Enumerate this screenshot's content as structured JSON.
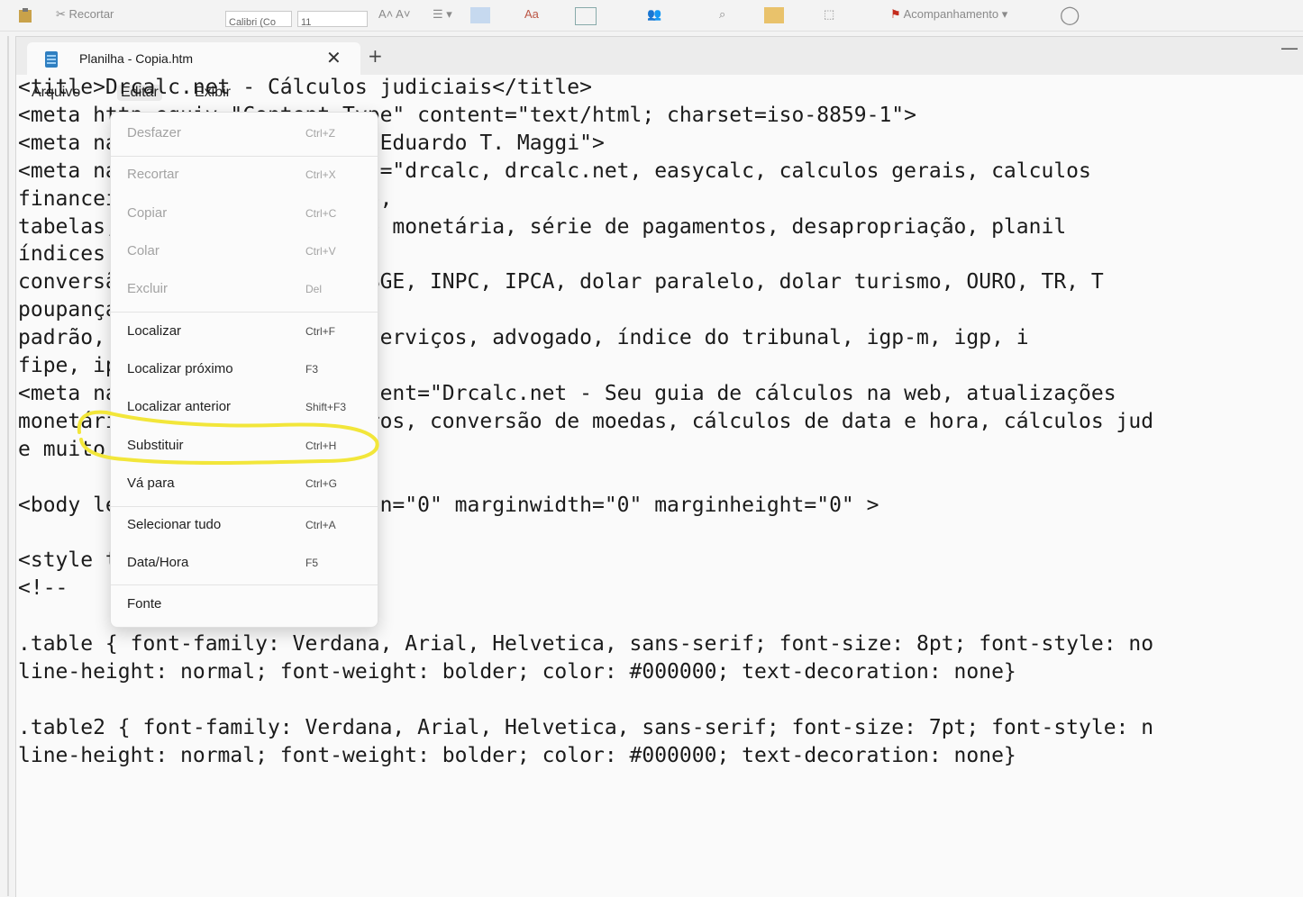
{
  "ribbon": {
    "cut_label": "Recortar",
    "font_name": "Calibri (Co",
    "font_size": "11",
    "tracking_label": "Acompanhamento"
  },
  "tab": {
    "title": "Planilha - Copia.htm",
    "close": "✕",
    "new_tab": "+"
  },
  "window": {
    "minimize": "—"
  },
  "menubar": {
    "items": [
      {
        "label": "Arquivo"
      },
      {
        "label": "Editar"
      },
      {
        "label": "Exibir"
      }
    ]
  },
  "edit_menu": {
    "items": [
      {
        "label": "Desfazer",
        "shortcut": "Ctrl+Z",
        "enabled": false
      },
      {
        "label": "Recortar",
        "shortcut": "Ctrl+X",
        "enabled": false
      },
      {
        "label": "Copiar",
        "shortcut": "Ctrl+C",
        "enabled": false
      },
      {
        "label": "Colar",
        "shortcut": "Ctrl+V",
        "enabled": false
      },
      {
        "label": "Excluir",
        "shortcut": "Del",
        "enabled": false
      },
      {
        "label": "Localizar",
        "shortcut": "Ctrl+F",
        "enabled": true
      },
      {
        "label": "Localizar próximo",
        "shortcut": "F3",
        "enabled": true
      },
      {
        "label": "Localizar anterior",
        "shortcut": "Shift+F3",
        "enabled": true
      },
      {
        "label": "Substituir",
        "shortcut": "Ctrl+H",
        "enabled": true
      },
      {
        "label": "Vá para",
        "shortcut": "Ctrl+G",
        "enabled": true
      },
      {
        "label": "Selecionar tudo",
        "shortcut": "Ctrl+A",
        "enabled": true
      },
      {
        "label": "Data/Hora",
        "shortcut": "F5",
        "enabled": true
      },
      {
        "label": "Fonte",
        "shortcut": "",
        "enabled": true
      }
    ]
  },
  "highlight_color": "#f2e63a",
  "editor": {
    "lines": [
      "<title>Drcalc.net - Cálculos judiciais</title>",
      "<meta http-equiv=\"Content-Type\" content=\"text/html; charset=iso-8859-1\">",
      "<meta name=\"author\" content=\"Eduardo T. Maggi\">",
      "<meta name=\"keywords\" content=\"drcalc, drcalc.net, easycalc, calculos gerais, calculos",
      "financeiros, cálculo jurídico,",
      "tabelas, índices, atualização monetária, série de pagamentos, desapropriação, planil",
      "índices financeiros,",
      "conversão de moedas, FIPE, IBGE, INPC, IPCA, dolar paralelo, dolar turismo, OURO, TR, T",
      "poupança,",
      "padrão, tribunal, negocios, serviços, advogado, índice do tribunal, igp-m, igp, i",
      "fipe, ipca\">",
      "<meta name=\"description\" content=\"Drcalc.net - Seu guia de cálculos na web, atualizações",
      "monetárias, índices financeiros, conversão de moedas, cálculos de data e hora, cálculos jud",
      "e muito mais\">",
      "",
      "<body leftmargin=\"0\" topmargin=\"0\" marginwidth=\"0\" marginheight=\"0\" >",
      "",
      "<style type=\"text/css\">",
      "<!--",
      "",
      ".table { font-family: Verdana, Arial, Helvetica, sans-serif; font-size: 8pt; font-style: no",
      "line-height: normal; font-weight: bolder; color: #000000; text-decoration: none}",
      "",
      ".table2 { font-family: Verdana, Arial, Helvetica, sans-serif; font-size: 7pt; font-style: n",
      "line-height: normal; font-weight: bolder; color: #000000; text-decoration: none}"
    ]
  }
}
